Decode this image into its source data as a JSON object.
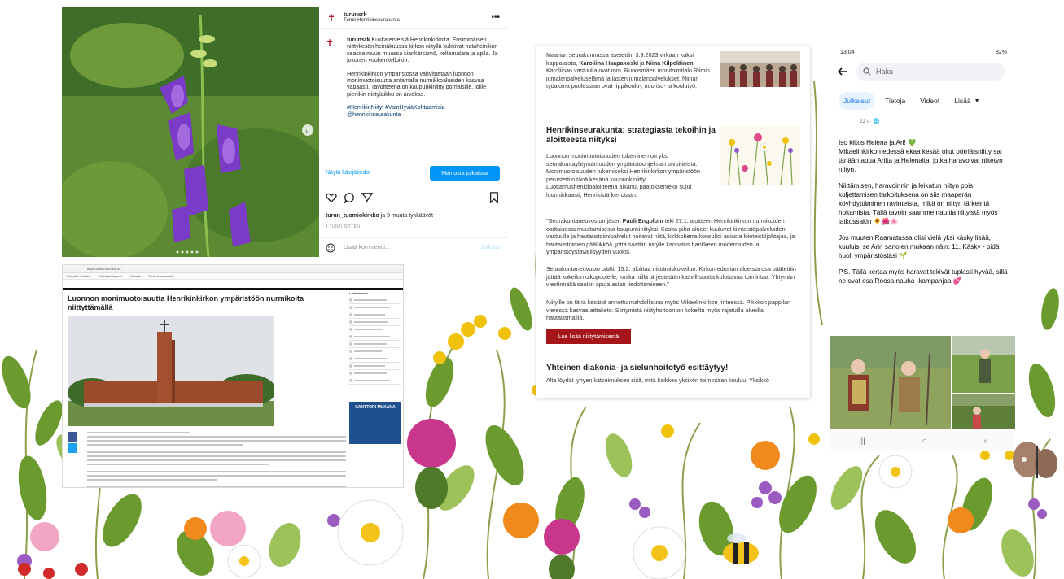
{
  "instagram": {
    "account": "turunsrk",
    "account_subtitle": "Turun Henrikinseurakunta",
    "caption_user": "turunsrk",
    "caption_p1": "Kukkaterveisiä Henrikinkirkolta. Ensimmäisen niittykesän heinäkuussa kirkon niityllä kukkivat nataheinikon seassa muun muassa siankärsämö, keltamatara ja apila. Ja jokunen vuohenkelloikin.",
    "caption_p2": "Henrikinkirkon ympäristössä vahvistetaan luonnon monimuotoisuutta antamalla nurmikkoalueiden kasvaa vapaasti. Tavoitteena on kaupunkiniitty pörriäisille, joille pienikin niittylaikku on arvokas.",
    "hashtags": "#HenrikinNiityt #VainHyviäKohtaamisia",
    "mention": "@henrikinseurakunta",
    "insights_link": "Näytä kävijätiedot",
    "promote_button": "Mainosta julkaisua",
    "liked_user": "turun_tuomiokirkko",
    "liked_rest": "ja 9 muuta tykkäävät",
    "time_ago": "1 TUNTI SITTEN",
    "comment_placeholder": "Lisää kommentti...",
    "post_button": "Julkaise",
    "icons": [
      "heart-icon",
      "comment-icon",
      "share-icon",
      "bookmark-icon",
      "emoji-icon",
      "more-icon"
    ]
  },
  "web": {
    "url": "https://www.turunsrk.fi/...",
    "bookmarks": [
      "Yleisradio – Uutiset",
      "Kirkko ja kaupunki",
      "Kotimaa",
      "Turun seurakunnat"
    ],
    "title": "Luonnon monimuotoisuutta Henrikinkirkon ympäristöön nurmikoita niittyttämällä",
    "sidebar_heading": "Luetuimmat",
    "ad_text": "KANTTORI MUKANA"
  },
  "article": {
    "p1_a": "Maarian seurakunnassa asetettiin 3.9.2023 virkaan kaksi kappalaista,",
    "p1_name1": "Karoliina Haapakoski",
    "p1_and": "ja",
    "p1_name2": "Niina Kilpeläinen",
    "p1_b": ". Karoliinan vastuulla ovat mm. Runosmäen monitoimitalo Riimin jumalanpalveluselämä ja lasten jumalanpalvelukset, Niinan työaloina puolestaan ovat rippikoulu-, nuoriso- ja koulutyö.",
    "h1": "Henrikinseurakunta: strategiasta tekoihin ja aloitteesta niityksi",
    "p2": "Luonnon monimuotoisuuden tukeminen on yksi seurakuntayhtymän uuden ympäristöohjelman tavoitteista. Monimuotoisuuden tukemiseksi Henrikinkirkon ympäristöön perustettiin tänä kesänä kaupunkiniitty. Luottamushenkilöaloitteena alkanut päätöksenteko sujui luonnikkaasti, Henrikistä kerrotaan:",
    "p3_a": "\"Seurakuntaneuvoston jäsen",
    "p3_name": "Pauli Engblom",
    "p3_b": "teki 27.1. aloitteen Henrikinkirkon nurmikoiden osittaisesta muuttamisesta kaupunkiniityksi. Koska piha-alueet kuuluvat kiinteistöpalveluiden vastuulle ja hautaustoimipalvelut hoitavat niitä, kirkkoherra konsultoi asiasta kiinteistöjohtajaa, ja hautaustoimen päällikköä, jotta saattiin niitylle kannatus hankkeen moderniuden ja ympäristöystävällisyyden vuoksi.",
    "p4": "Seurakuntaneuvosto päätti 15.2. aloittaa niittämiskokeilun. Kirkon edustan alueista osa päätettiin jättää kokeilun ulkopuolelle, koska niillä järjestetään kasvillisuutta kuluttavaa toimintaa. Yhtymän viestinnältä saatiin apuja asian tiedottamiseen.\"",
    "p5": "Niityille on tänä kesänä annettu mahdollisuus myös Mikaelinkirkon rinteessä. Pikkkon pappilan vieressä kasvaa aittaketo. Siirtymistä niittyhoitoon on kokeiltu myös rajatuilla alueilla hautausmailla.",
    "button": "Lue lisää niittytämisestä",
    "h2": "Yhteinen diakonia- ja sielunhoitotyö esittäytyy!",
    "p6": "Alta löydät lyhyen katseimuksen siitä, mitä kaikkea yksikön toimintaan kuuluu. Yksikkö"
  },
  "facebook": {
    "time": "13.04",
    "battery": "82%",
    "search_placeholder": "Haku",
    "tabs": [
      "Julkaisut",
      "Tietoja",
      "Videot",
      "Lisää"
    ],
    "post_meta": "22 t · ",
    "p1_line1": "Iso kiitos Helena ja Ari! 💚",
    "p1_line2": "Mikaelinkirkon edessä ekaa kesää ollut pörriäisniitty sai tänään apua Arilta ja Helenalta, jotka haravoivat niitetyn niityn.",
    "p2": "Niittämisen, haravoinnin ja leikatun niityn pois kuljettamisen tarkoituksena on siis maaperän köyhdyttäminen ravinteista, mikä on niityn tärkeintä hoitamista. Tällä tavoin saamme nauttia niityistä myös jatkossakin 🌻🌺🌸",
    "p3": "Jos muuten Raamatussa olisi vielä yksi käsky lisää, kuuluisi se Arin sanojen mukaan näin: 11. Käsky - pidä huoli ympäristöstäsi 🌱",
    "p4": "P.S. Tällä kertaa myös haravat tekivät tuplasti hyvää, sillä ne ovat osa Roosa nauha -kampanjaa 💕",
    "nav": [
      "|||",
      "○",
      "‹"
    ]
  },
  "colors": {
    "instagram_blue": "#0095f6",
    "parish_red": "#a4161a",
    "facebook_blue": "#1877f2"
  }
}
